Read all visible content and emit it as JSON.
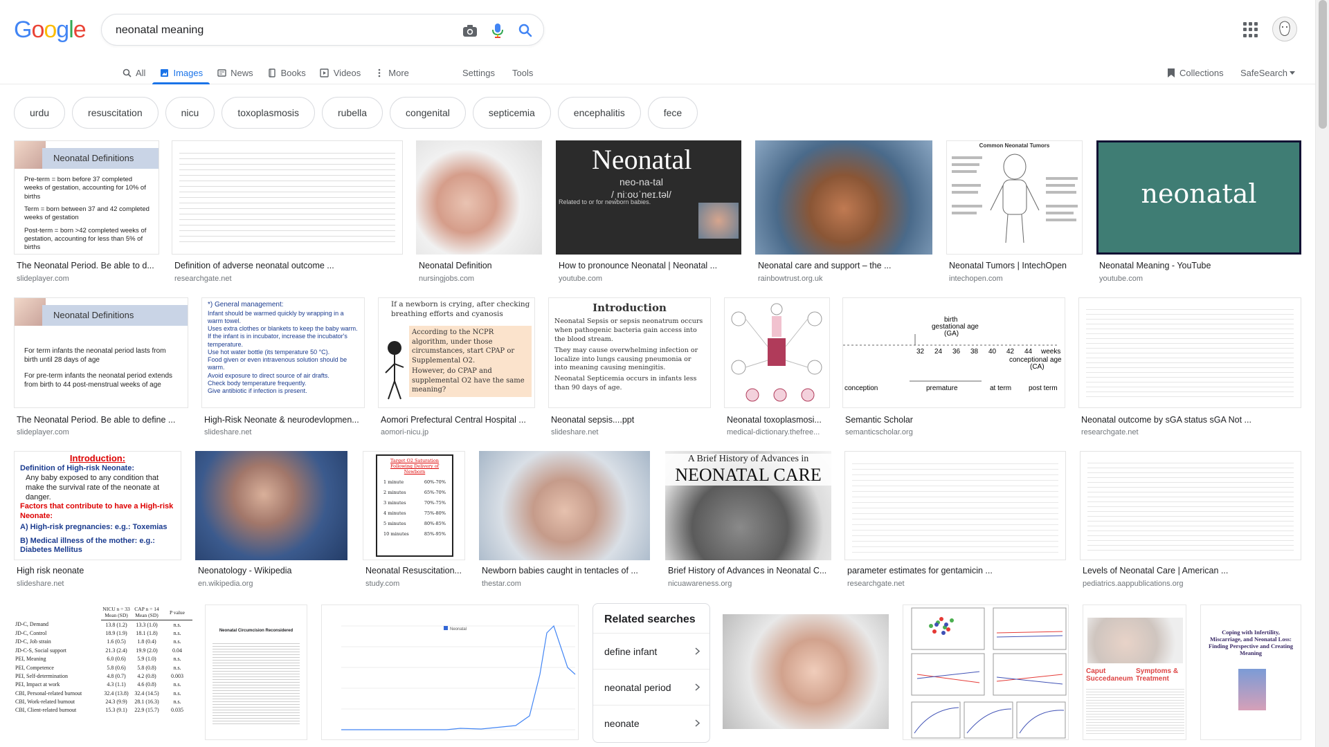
{
  "logo": {
    "letters": [
      "G",
      "o",
      "o",
      "g",
      "l",
      "e"
    ],
    "colors": [
      "#4285F4",
      "#EA4335",
      "#FBBC05",
      "#4285F4",
      "#34A853",
      "#EA4335"
    ]
  },
  "search": {
    "value": "neonatal meaning",
    "placeholder": ""
  },
  "tabs": [
    {
      "label": "All",
      "icon": "search-icon",
      "active": false
    },
    {
      "label": "Images",
      "icon": "image-icon",
      "active": true
    },
    {
      "label": "News",
      "icon": "news-icon",
      "active": false
    },
    {
      "label": "Books",
      "icon": "book-icon",
      "active": false
    },
    {
      "label": "Videos",
      "icon": "video-icon",
      "active": false
    },
    {
      "label": "More",
      "icon": "more-vert-icon",
      "active": false
    }
  ],
  "settings_label": "Settings",
  "tools_label": "Tools",
  "collections_label": "Collections",
  "safesearch_label": "SafeSearch",
  "accent_color": "#1a73e8",
  "chips": [
    "urdu",
    "resuscitation",
    "nicu",
    "toxoplasmosis",
    "rubella",
    "congenital",
    "septicemia",
    "encephalitis",
    "fece"
  ],
  "row1": [
    {
      "title": "The Neonatal Period. Be able to d...",
      "source": "slideplayer.com",
      "slide_heading": "Neonatal Definitions",
      "slide_lines": [
        "Pre-term = born before 37 completed weeks of gestation, accounting for 10% of births",
        "Term = born between 37 and 42 completed weeks of gestation",
        "Post-term = born >42 completed weeks of gestation, accounting for less than 5% of births"
      ]
    },
    {
      "title": "Definition of adverse neonatal outcome ...",
      "source": "researchgate.net"
    },
    {
      "title": "Neonatal Definition",
      "source": "nursingjobs.com"
    },
    {
      "title": "How to pronounce Neonatal | Neonatal ...",
      "source": "youtube.com",
      "card_word": "Neonatal",
      "card_phonetic": "neo-na-tal",
      "card_ipa": "/ˌniːoʊˈneɪ.təl/",
      "card_caption": "Related to or for newborn babies."
    },
    {
      "title": "Neonatal care and support – the ...",
      "source": "rainbowtrust.org.uk"
    },
    {
      "title": "Neonatal Tumors | IntechOpen",
      "source": "intechopen.com",
      "card_heading": "Common Neonatal Tumors"
    },
    {
      "title": "Neonatal Meaning - YouTube",
      "source": "youtube.com",
      "card_word": "neonatal"
    }
  ],
  "row2": [
    {
      "title": "The Neonatal Period. Be able to define ...",
      "source": "slideplayer.com",
      "slide_heading": "Neonatal Definitions",
      "slide_lines": [
        "For term infants the neonatal period lasts from birth until 28 days of age",
        "For pre-term infants the neonatal period extends from birth to 44 post-menstrual weeks of age"
      ]
    },
    {
      "title": "High-Risk Neonate & neurodevlopmen...",
      "source": "slideshare.net",
      "card_heading": "*) General management:",
      "card_lines": [
        "Infant should be warmed quickly by wrapping in a warm towel.",
        "Uses extra clothes or blankets to keep the baby warm.",
        "If the infant is in incubator, increase the incubator's temperature.",
        "Use hot water bottle (its temperature 50 °C).",
        "Food given or even intravenous solution should be warm.",
        "Avoid exposure to direct source of air drafts.",
        "Check body temperature frequently.",
        "Give antibiotic if infection is present."
      ]
    },
    {
      "title": "Aomori Prefectural Central Hospital ...",
      "source": "aomori-nicu.jp",
      "card_heading": "If a newborn is crying, after checking breathing efforts and cyanosis",
      "card_box1": "According to the NCPR algorithm, under those circumstances, start CPAP or Supplemental O2.",
      "card_box2": "However, do CPAP and supplemental O2 have the same meaning?"
    },
    {
      "title": "Neonatal sepsis....ppt",
      "source": "slideshare.net",
      "card_heading": "Introduction",
      "card_lines": [
        "Neonatal Sepsis or sepsis neonatrum occurs when pathogenic bacteria gain access into the blood stream.",
        "They may cause overwhelming infection or localize into lungs causing pneumonia or into meaning causing meningitis.",
        "Neonatal Septicemia occurs in infants less than 90 days of age."
      ]
    },
    {
      "title": "Neonatal toxoplasmosi...",
      "source": "medical-dictionary.thefree..."
    },
    {
      "title": "Semantic Scholar",
      "source": "semanticscholar.org",
      "card_labels": [
        "birth",
        "gestational age",
        "(GA)",
        "conception",
        "premature",
        "at term",
        "post term",
        "conceptional age",
        "(CA)",
        "weeks"
      ],
      "card_ticks": [
        "32",
        "24",
        "36",
        "38",
        "40",
        "42",
        "44"
      ]
    },
    {
      "title": "Neonatal outcome by sGA status sGA Not ...",
      "source": "researchgate.net"
    }
  ],
  "row3": [
    {
      "title": "High risk neonate",
      "source": "slideshare.net",
      "card_heading": "Introduction:",
      "card_sub1": "Definition of High-risk Neonate:",
      "card_text1": "Any baby exposed to any condition that make the survival rate of the neonate at danger.",
      "card_sub2": "Factors that contribute to have a High-risk Neonate:",
      "card_a": "A) High-risk pregnancies: e.g.: Toxemias",
      "card_b": "B) Medical illness of the mother: e.g.: Diabetes Mellitus"
    },
    {
      "title": "Neonatology - Wikipedia",
      "source": "en.wikipedia.org"
    },
    {
      "title": "Neonatal Resuscitation...",
      "source": "study.com",
      "card_heading": "Target O2 Saturation Following Delivery of Newborn",
      "card_rows": [
        [
          "1 minute",
          "60%-70%"
        ],
        [
          "2 minutes",
          "65%-70%"
        ],
        [
          "3 minutes",
          "70%-75%"
        ],
        [
          "4 minutes",
          "75%-80%"
        ],
        [
          "5 minutes",
          "80%-85%"
        ],
        [
          "10 minutes",
          "85%-95%"
        ]
      ]
    },
    {
      "title": "Newborn babies caught in tentacles of ...",
      "source": "thestar.com"
    },
    {
      "title": "Brief History of Advances in Neonatal C...",
      "source": "nicuawareness.org",
      "card_heading": "A Brief History of Advances in",
      "card_big": "NEONATAL CARE"
    },
    {
      "title": "parameter estimates for gentamicin ...",
      "source": "researchgate.net"
    },
    {
      "title": "Levels of Neonatal Care | American ...",
      "source": "pediatrics.aappublications.org"
    }
  ],
  "row4": [
    {
      "card_cols": [
        "NICU n = 33 Mean (SD)",
        "CAP n = 14 Mean (SD)",
        "P value"
      ],
      "card_rows": [
        [
          "JD-C, Demand",
          "13.8 (1.2)",
          "13.3 (1.0)",
          "n.s."
        ],
        [
          "JD-C, Control",
          "18.9 (1.9)",
          "18.1 (1.8)",
          "n.s."
        ],
        [
          "JD-C, Job strain",
          "1.6 (0.5)",
          "1.8 (0.4)",
          "n.s."
        ],
        [
          "JD-C-S, Social support",
          "21.3 (2.4)",
          "19.9 (2.0)",
          "0.04"
        ],
        [
          "PEI, Meaning",
          "6.0 (0.6)",
          "5.9 (1.0)",
          "n.s."
        ],
        [
          "PEI, Competence",
          "5.8 (0.6)",
          "5.8 (0.8)",
          "n.s."
        ],
        [
          "PEI, Self-determination",
          "4.8 (0.7)",
          "4.2 (0.8)",
          "0.003"
        ],
        [
          "PEI, Impact at work",
          "4.3 (1.1)",
          "4.6 (0.8)",
          "n.s."
        ],
        [
          "CBI, Personal-related burnout",
          "32.4 (13.8)",
          "32.4 (14.5)",
          "n.s."
        ],
        [
          "CBI, Work-related burnout",
          "24.3 (9.9)",
          "28.1 (16.3)",
          "n.s."
        ],
        [
          "CBI, Client-related burnout",
          "15.3 (9.1)",
          "22.9 (15.7)",
          "0.035"
        ]
      ]
    },
    {
      "card_heading": "Neonatal Circumcision Reconsidered"
    },
    {
      "card_legend": "Neonatal"
    },
    {
      "card_heading": "Caput Succedaneum",
      "card_heading2": "Symptoms & Treatment"
    },
    {
      "card_heading": "Coping with Infertility, Miscarriage, and Neonatal Loss: Finding Perspective and Creating Meaning"
    }
  ],
  "related": {
    "heading": "Related searches",
    "items": [
      "define infant",
      "neonatal period",
      "neonate"
    ]
  }
}
